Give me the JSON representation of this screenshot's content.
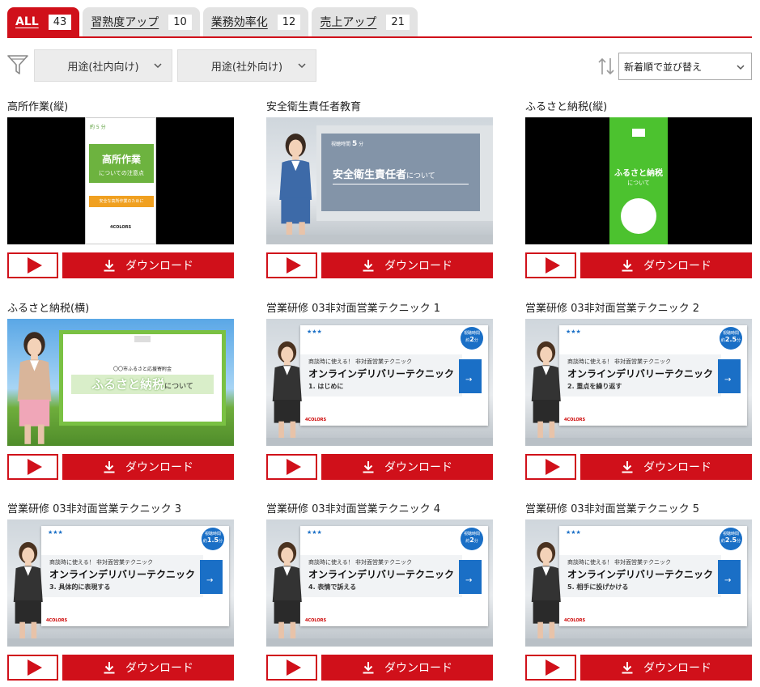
{
  "tabs": [
    {
      "label": "ALL",
      "count": "43",
      "active": true
    },
    {
      "label": "習熟度アップ",
      "count": "10"
    },
    {
      "label": "業務効率化",
      "count": "12"
    },
    {
      "label": "売上アップ",
      "count": "21"
    }
  ],
  "filters": {
    "internal_label": "用途(社内向け)",
    "external_label": "用途(社外向け)",
    "sort_label": "新着順で並び替え"
  },
  "buttons": {
    "download_label": "ダウンロード"
  },
  "colors": {
    "accent": "#d0101a",
    "tab_inactive": "#e3e3e3"
  },
  "videos": [
    {
      "title": "高所作業(縦)",
      "thumb_kind": "portrait-work"
    },
    {
      "title": "安全衛生責任者教育",
      "thumb_kind": "safety"
    },
    {
      "title": "ふるさと納税(縦)",
      "thumb_kind": "portrait-tax"
    },
    {
      "title": "ふるさと納税(横)",
      "thumb_kind": "tax-landscape"
    },
    {
      "title": "営業研修 03非対面営業テクニック 1",
      "thumb_kind": "sales",
      "chapter": "1. はじめに",
      "minutes": "2"
    },
    {
      "title": "営業研修 03非対面営業テクニック 2",
      "thumb_kind": "sales",
      "chapter": "2. 重点を繰り返す",
      "minutes": "2.5"
    },
    {
      "title": "営業研修 03非対面営業テクニック 3",
      "thumb_kind": "sales",
      "chapter": "3. 具体的に表現する",
      "minutes": "1.5"
    },
    {
      "title": "営業研修 03非対面営業テクニック 4",
      "thumb_kind": "sales",
      "chapter": "4. 表情で訴える",
      "minutes": "2"
    },
    {
      "title": "営業研修 03非対面営業テクニック 5",
      "thumb_kind": "sales",
      "chapter": "5. 相手に投げかける",
      "minutes": "2.5"
    }
  ],
  "thumb_text": {
    "work_heading": "高所作業",
    "work_sub": "についての注意点",
    "work_minutes": "約 5 分",
    "work_band": "安全な高所作業のために",
    "brand": "4COLORS",
    "safety_heading": "安全衛生責任者",
    "safety_suffix": "について",
    "safety_minutes": "5",
    "tax_heading": "ふるさと納税",
    "tax_sub": "について",
    "tax_org": "〇〇市ふるさと応援寄附金",
    "sales_kicker": "商談時に使える！ 非対面営業テクニック",
    "sales_heading": "オンラインデリバリーテクニック",
    "sales_time_label": "視聴時間",
    "sales_time_prefix": "約",
    "sales_time_suffix": "分"
  }
}
